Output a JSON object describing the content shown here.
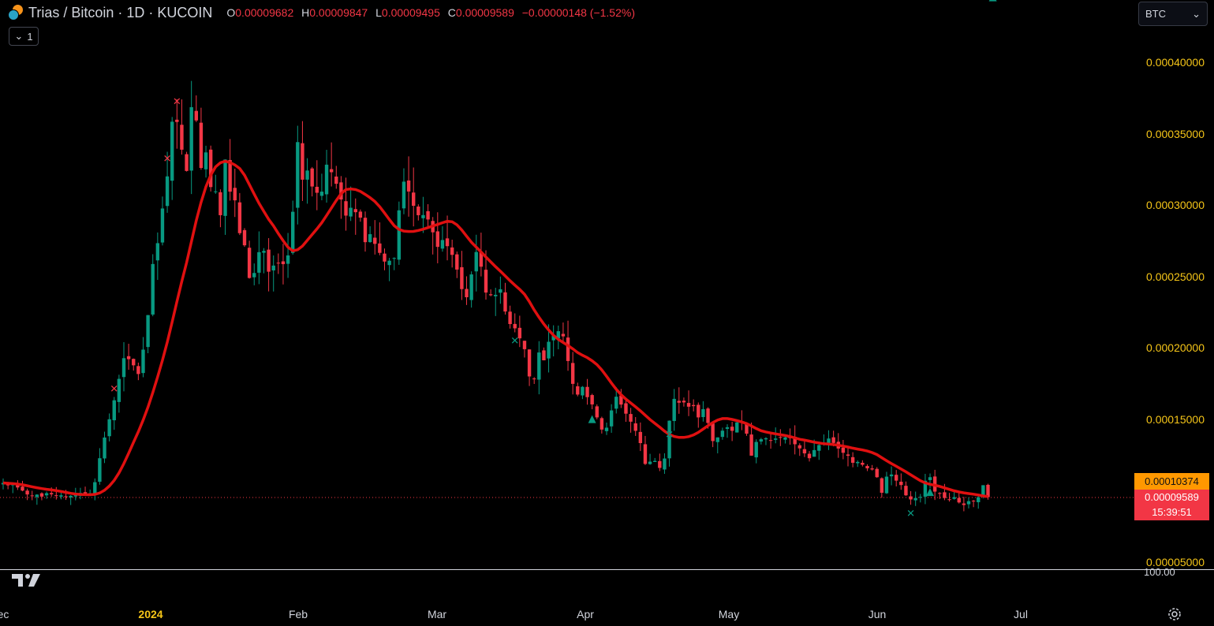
{
  "header": {
    "symbol_title": "Trias / Bitcoin · 1D · KUCOIN",
    "ohlc": [
      {
        "k": "O",
        "v": "0.00009682"
      },
      {
        "k": "H",
        "v": "0.00009847"
      },
      {
        "k": "L",
        "v": "0.00009495"
      },
      {
        "k": "C",
        "v": "0.00009589"
      }
    ],
    "change": "−0.00000148 (−1.52%)"
  },
  "indicator_toggle": {
    "count": "1"
  },
  "currency_select": {
    "value": "BTC"
  },
  "price_axis": {
    "labels": [
      "0.00040000",
      "0.00035000",
      "0.00030000",
      "0.00025000",
      "0.00020000",
      "0.00015000",
      "0.00005000"
    ],
    "line_tag": "0.00010374",
    "last_price": "0.00009589",
    "countdown": "15:39:51",
    "volume_label": "100.00"
  },
  "time_axis": {
    "labels": [
      "ec",
      "2024",
      "Feb",
      "Mar",
      "Apr",
      "May",
      "Jun",
      "Jul"
    ]
  },
  "colors": {
    "up": "#089981",
    "down": "#f23645",
    "line_bull": "#1b7b1e",
    "line_bear": "#e01010",
    "line_neutral": "#ff9800",
    "axis_text": "#f5c518"
  },
  "chart_data": {
    "type": "candlestick",
    "symbol": "Trias / Bitcoin",
    "interval": "1D",
    "exchange": "KUCOIN",
    "y_range": [
      4e-05,
      0.00041
    ],
    "x_ticks": [
      "Dec",
      "2024",
      "Feb",
      "Mar",
      "Apr",
      "May",
      "Jun",
      "Jul"
    ],
    "closes": [
      0.0001058,
      0.0001041,
      0.0001049,
      0.0001026,
      0.0001004,
      9.77e-05,
      9.65e-05,
      9.76e-05,
      9.62e-05,
      9.86e-05,
      9.78e-05,
      9.67e-05,
      9.71e-05,
      9.59e-05,
      9.68e-05,
      9.72e-05,
      9.88e-05,
      9.77e-05,
      9.85e-05,
      0.0001063,
      0.0001231,
      0.0001376,
      0.0001504,
      0.0001637,
      0.0001787,
      0.0001932,
      0.0001925,
      0.0001882,
      0.0001821,
      0.0001992,
      0.0002234,
      0.0002592,
      0.0002738,
      0.0002981,
      0.0003206,
      0.0003589,
      0.0003587,
      0.0003393,
      0.0003244,
      0.0003691,
      0.0003598,
      0.0003265,
      0.0003374,
      0.0003131,
      0.0003101,
      0.0002934,
      0.0003324,
      0.0003099,
      0.0003038,
      0.0002808,
      0.0002723,
      0.0002494,
      0.0002529,
      0.0002675,
      0.0002684,
      0.0002538,
      0.0002581,
      0.00026,
      0.0002591,
      0.0002652,
      0.0002958,
      0.0003446,
      0.0003183,
      0.0003247,
      0.0003135,
      0.0003091,
      0.0003099,
      0.0003288,
      0.0003235,
      0.0003154,
      0.0003044,
      0.0002931,
      0.0002986,
      0.0002955,
      0.0002917,
      0.0002745,
      0.0002801,
      0.0002733,
      0.000267,
      0.0002609,
      0.0002615,
      0.0002634,
      0.0002968,
      0.0003169,
      0.00031,
      0.0003,
      0.0002934,
      0.0002935,
      0.0002904,
      0.0002814,
      0.0002712,
      0.000276,
      0.0002717,
      0.0002656,
      0.0002553,
      0.0002416,
      0.0002359,
      0.0002519,
      0.0002676,
      0.0002573,
      0.0002392,
      0.0002373,
      0.0002376,
      0.0002415,
      0.0002259,
      0.0002171,
      0.0002141,
      0.0002071,
      0.0001995,
      0.0001804,
      0.0001784,
      0.0001972,
      0.0001917,
      0.0002047,
      0.0002091,
      0.0002121,
      0.0002085,
      0.0001912,
      0.0001752,
      0.0001677,
      0.0001731,
      0.0001659,
      0.0001608,
      0.0001517,
      0.0001432,
      0.0001445,
      0.0001566,
      0.0001662,
      0.0001607,
      0.0001543,
      0.0001487,
      0.0001423,
      0.0001337,
      0.0001191,
      0.0001207,
      0.0001212,
      0.0001163,
      0.0001229,
      0.0001494,
      0.0001647,
      0.000162,
      0.0001622,
      0.0001592,
      0.0001596,
      0.0001517,
      0.0001575,
      0.0001478,
      0.0001351,
      0.0001377,
      0.0001424,
      0.0001448,
      0.0001423,
      0.0001482,
      0.0001486,
      0.0001403,
      0.0001249,
      0.0001345,
      0.0001364,
      0.0001371,
      0.0001355,
      0.0001369,
      0.0001374,
      0.0001377,
      0.0001374,
      0.0001329,
      0.00013,
      0.0001265,
      0.0001231,
      0.0001288,
      0.0001323,
      0.0001337,
      0.0001369,
      0.0001338,
      0.0001299,
      0.0001269,
      0.0001248,
      0.0001199,
      0.0001205,
      0.0001185,
      0.000116,
      0.0001152,
      0.0001098,
      9.89e-05,
      0.0001102,
      0.0001117,
      0.0001074,
      0.0001043,
      9.71e-05,
      9.42e-05,
      9.52e-05,
      9.6e-05,
      0.0001073,
      0.0001098,
      9.97e-05,
      9.83e-05,
      9.52e-05,
      9.43e-05,
      9.58e-05,
      9.21e-05,
      9.03e-05,
      9.3e-05,
      9.29e-05,
      9.58e-05,
      0.0001042,
      9.58e-05
    ]
  }
}
